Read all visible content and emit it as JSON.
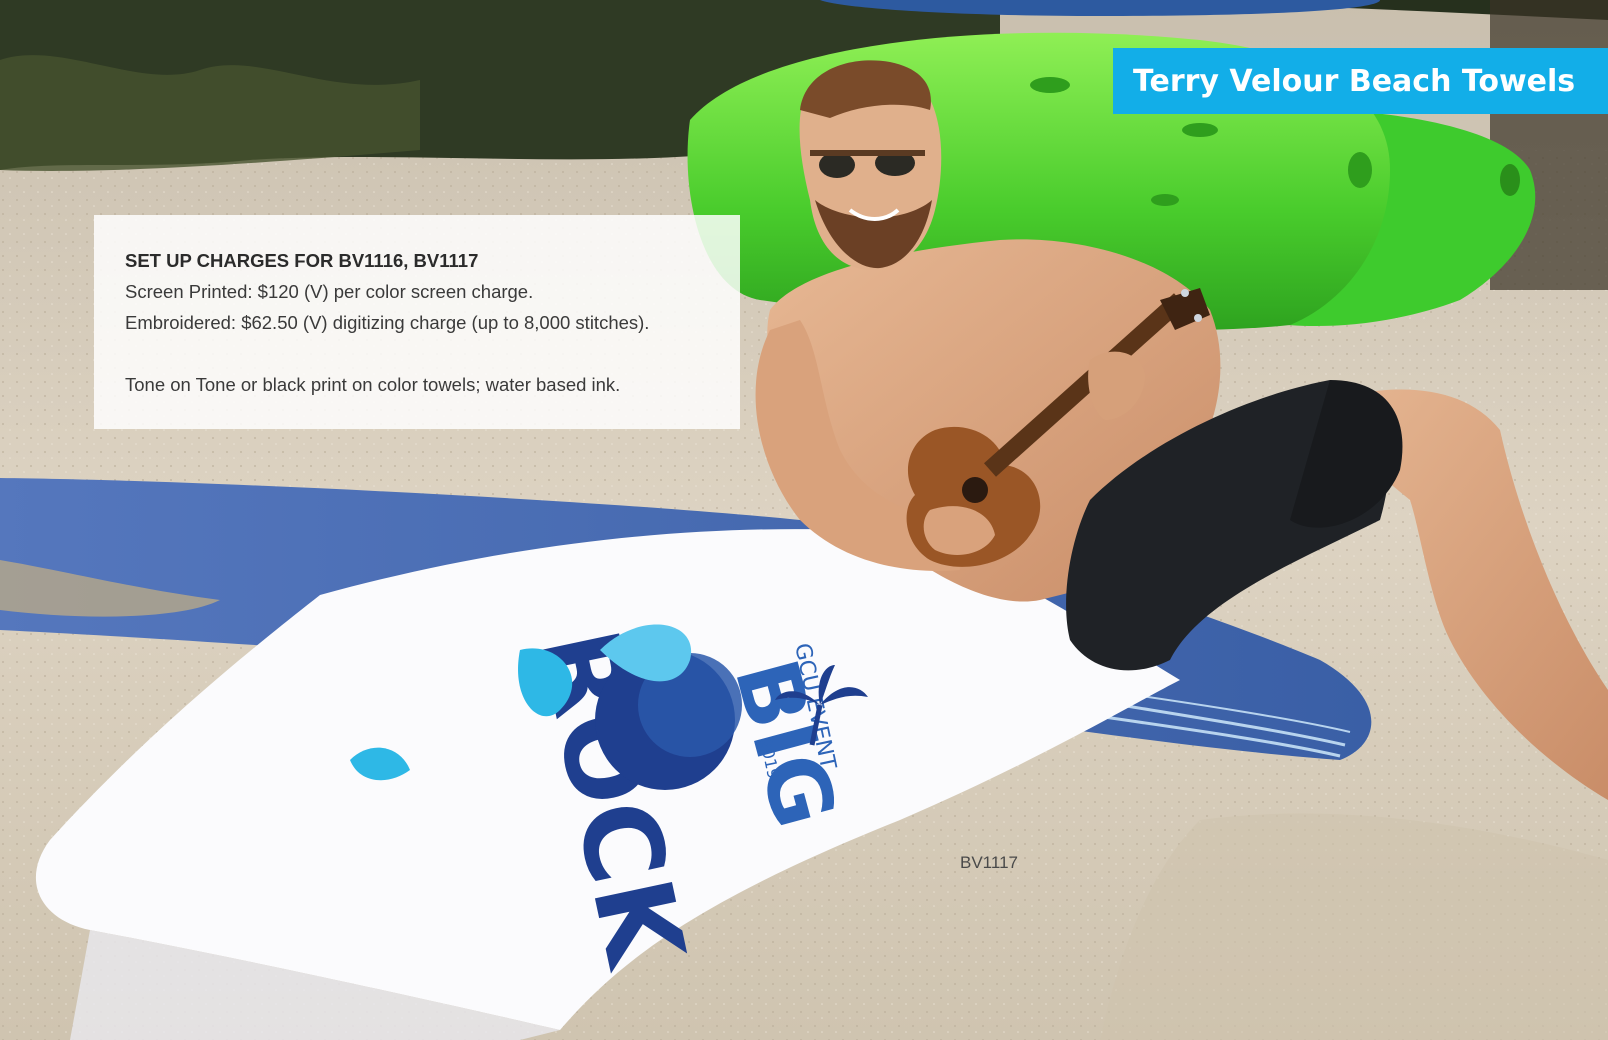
{
  "header": {
    "title": "Terry Velour Beach Towels"
  },
  "setup_charges": {
    "heading": "SET UP CHARGES FOR BV1116, BV1117",
    "screen_printed": "Screen Printed: $120 (V) per color screen charge.",
    "embroidered": "Embroidered: $62.50 (V) digitizing charge (up to 8,000 stitches).",
    "note": "Tone on Tone or black print on color towels; water based ink."
  },
  "product": {
    "code": "BV1117"
  },
  "towel_print": {
    "big": "BIG",
    "rock": "ROCK",
    "event": "GCU EVENT",
    "year": "2019"
  },
  "colors": {
    "banner": "#12aee8",
    "sand": "#d9cfbd",
    "kayak_green": "#5fd93a",
    "board_blue": "#3a66b3",
    "towel_white": "#fbfbfd",
    "print_navy": "#1f3f8f",
    "print_cyan": "#2eb8e6"
  },
  "icons": [
    "palm-tree-icon",
    "sun-circle-icon"
  ]
}
